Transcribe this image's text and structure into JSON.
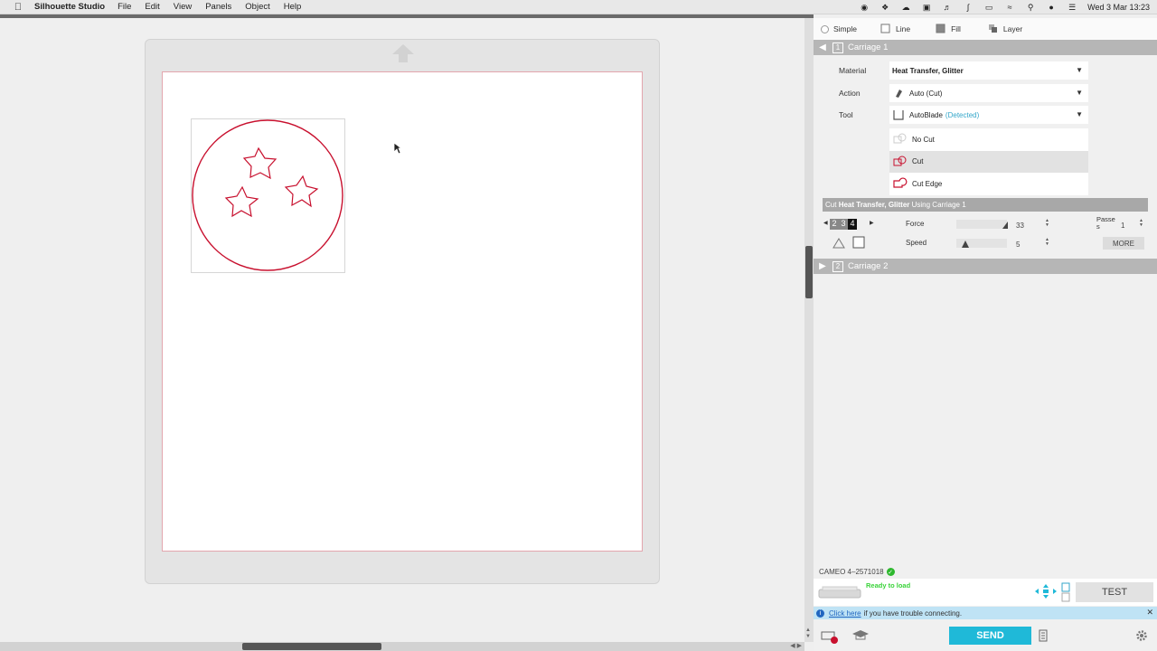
{
  "menubar": {
    "app_name": "Silhouette Studio",
    "items": [
      "File",
      "Edit",
      "View",
      "Panels",
      "Object",
      "Help"
    ],
    "clock": "Wed 3 Mar  13:23"
  },
  "panel": {
    "modes": [
      {
        "label": "Simple"
      },
      {
        "label": "Line"
      },
      {
        "label": "Fill"
      },
      {
        "label": "Layer"
      }
    ],
    "carriage1": {
      "num": "1",
      "label": "Carriage 1"
    },
    "carriage2": {
      "num": "2",
      "label": "Carriage 2"
    },
    "material_label": "Material",
    "material_value": "Heat Transfer, Glitter",
    "action_label": "Action",
    "action_value": "Auto (Cut)",
    "tool_label": "Tool",
    "tool_value": "AutoBlade",
    "tool_detected": "(Detected)",
    "actions": [
      {
        "label": "No Cut"
      },
      {
        "label": "Cut"
      },
      {
        "label": "Cut Edge"
      }
    ],
    "cut_summary": {
      "prefix": "Cut",
      "material": "Heat Transfer, Glitter",
      "suffix": "Using Carriage 1"
    },
    "blade_depths": [
      "2",
      "3",
      "4"
    ],
    "force_label": "Force",
    "force_value": "33",
    "speed_label": "Speed",
    "speed_value": "5",
    "passes_label": "Passe\ns",
    "passes_value": "1",
    "more_label": "MORE",
    "device": "CAMEO 4–2571018",
    "ready": "Ready to load",
    "test_label": "TEST",
    "info_link": "Click here",
    "info_text": "if you have trouble connecting.",
    "send_label": "SEND"
  },
  "colors": {
    "accent": "#1fb9d8",
    "cut_line": "#c8102e",
    "page_border": "#e3a6ae"
  }
}
